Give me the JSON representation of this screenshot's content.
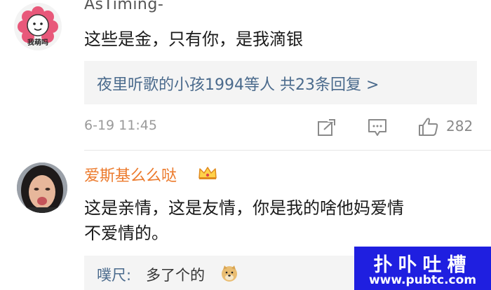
{
  "comment1": {
    "avatar_caption": "我萌吗",
    "username": "AsTiming-",
    "text": "这些是金，只有你，是我滴银",
    "reply_summary": "夜里听歌的小孩1994等人 共23条回复 >",
    "date": "6-19 11:45",
    "like_count": "282",
    "icons": [
      "share-icon",
      "comment-icon",
      "like-icon"
    ]
  },
  "comment2": {
    "username": "爱斯基么么哒",
    "badge_icon": "crown-icon",
    "text_line1": "这是亲情，这是友情，你是我的啥他妈爱情",
    "text_line2": "不爱情的。",
    "reply": {
      "name": "噗尺:",
      "text": "多了个的",
      "emoji_icon": "doge-icon"
    }
  },
  "watermark": {
    "title": "扑卟吐槽",
    "url": "www.pubtc.com"
  },
  "colors": {
    "link": "#4a6a8c",
    "username_vip": "#ec7a2c",
    "muted": "#9a9a9a",
    "reply_bg": "#f4f4f4",
    "watermark_bg": "#1f1fe0"
  }
}
